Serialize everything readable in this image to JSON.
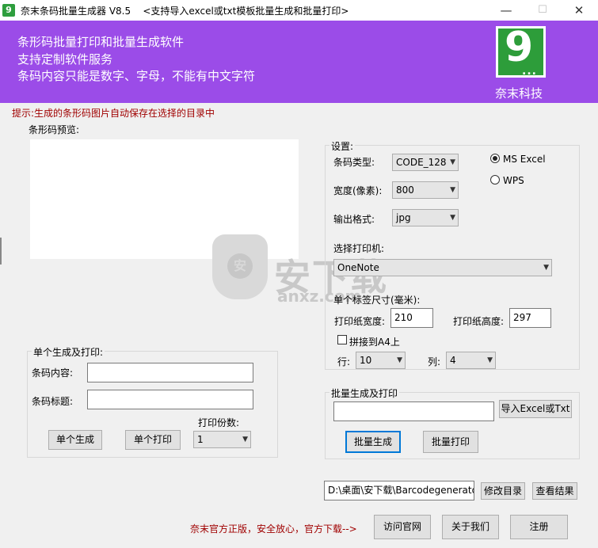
{
  "window": {
    "title": "奈末条码批量生成器 V8.5",
    "subtitle": "<支持导入excel或txt模板批量生成和批量打印>",
    "app_icon": "9",
    "minimize": "—",
    "maximize": "☐",
    "close": "✕"
  },
  "banner": {
    "line1": "条形码批量打印和批量生成软件",
    "line2": "支持定制软件服务",
    "line3": "条码内容只能是数字、字母，不能有中文字符",
    "logo_digit": "9",
    "logo_dots": "...",
    "company": "奈末科技",
    "bg_color": "#9b4ce8"
  },
  "hint": "提示:生成的条形码图片自动保存在选择的目录中",
  "preview": {
    "label": "条形码预览:"
  },
  "settings": {
    "title": "设置:",
    "barcode_type_label": "条码类型:",
    "barcode_type_value": "CODE_128",
    "width_label": "宽度(像素):",
    "width_value": "800",
    "format_label": "输出格式:",
    "format_value": "jpg",
    "radio_excel": "MS  Excel",
    "radio_wps": "WPS",
    "printer_label": "选择打印机:",
    "printer_value": "OneNote",
    "label_size_title": "单个标签尺寸(毫米):",
    "paper_width_label": "打印纸宽度:",
    "paper_width_value": "210",
    "paper_height_label": "打印纸高度:",
    "paper_height_value": "297",
    "a4_label": "拼接到A4上",
    "rows_label": "行:",
    "rows_value": "10",
    "cols_label": "列:",
    "cols_value": "4"
  },
  "single": {
    "title": "单个生成及打印:",
    "content_label": "条码内容:",
    "content_value": "",
    "caption_label": "条码标题:",
    "caption_value": "",
    "copies_label": "打印份数:",
    "copies_value": "1",
    "generate_btn": "单个生成",
    "print_btn": "单个打印"
  },
  "batch": {
    "title": "批量生成及打印",
    "file_value": "",
    "import_btn": "导入Excel或Txt",
    "generate_btn": "批量生成",
    "print_btn": "批量打印"
  },
  "output": {
    "dir_value": "D:\\桌面\\安下载\\Barcodegenerato",
    "change_dir_btn": "修改目录",
    "view_result_btn": "查看结果"
  },
  "footer": {
    "note": "奈末官方正版，安全放心，官方下载-->",
    "visit_btn": "访问官网",
    "about_btn": "关于我们",
    "register_btn": "注册"
  },
  "watermark": {
    "icon": "安",
    "text": "安下载",
    "sub": "anxz.com"
  }
}
